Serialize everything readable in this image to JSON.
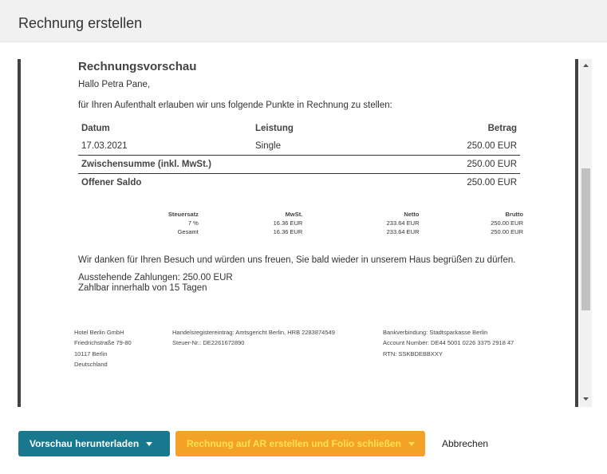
{
  "dialog": {
    "title": "Rechnung erstellen"
  },
  "invoice": {
    "heading": "Rechnungsvorschau",
    "greeting": "Hallo Petra Pane,",
    "intro": "für Ihren Aufenthalt erlauben wir uns folgende Punkte in Rechnung zu stellen:",
    "columns": {
      "date": "Datum",
      "service": "Leistung",
      "amount": "Betrag"
    },
    "items": [
      {
        "date": "17.03.2021",
        "service": "Single",
        "amount": "250.00 EUR"
      }
    ],
    "subtotal_label": "Zwischensumme (inkl. MwSt.)",
    "subtotal_value": "250.00 EUR",
    "balance_label": "Offener Saldo",
    "balance_value": "250.00 EUR",
    "tax": {
      "headers": {
        "rate": "Steuersatz",
        "vat": "MwSt.",
        "net": "Netto",
        "gross": "Brutto"
      },
      "rows": [
        {
          "rate": "7 %",
          "vat": "16.36 EUR",
          "net": "233.64 EUR",
          "gross": "250.00 EUR"
        },
        {
          "rate": "Gesamt",
          "vat": "16.36 EUR",
          "net": "233.64 EUR",
          "gross": "250.00 EUR"
        }
      ]
    },
    "thanks": "Wir danken für Ihren Besuch und würden uns freuen, Sie bald wieder in unserem Haus begrüßen zu dürfen.",
    "outstanding": "Ausstehende Zahlungen: 250.00 EUR",
    "due": "Zahlbar innerhalb von 15 Tagen",
    "footer": {
      "address": [
        "Hotel Berlin GmbH",
        "Friedrichstraße 79-80",
        "10117 Berlin",
        "Deutschland"
      ],
      "registry": [
        "Handelsregistereintrag: Amtsgericht Berlin, HRB 2283874549",
        "Steuer-Nr.: DE2261672890"
      ],
      "bank": [
        "Bankverbindung: Stadtsparkasse Berlin",
        "Account Number: DE44 5001 0226 3375 2918 47",
        "RTN: SSKBDEBBXXY"
      ]
    }
  },
  "actions": {
    "download_label": "Vorschau herunterladen",
    "create_label": "Rechnung auf AR erstellen und Folio schließen",
    "cancel_label": "Abbrechen"
  },
  "colors": {
    "primary": "#17788e",
    "accent": "#f4a128",
    "accent_text": "#ffe34d",
    "frame": "#424242"
  },
  "icons": {
    "dropdown": "caret-down-icon",
    "scroll_up": "arrow-up-icon",
    "scroll_down": "arrow-down-icon"
  }
}
